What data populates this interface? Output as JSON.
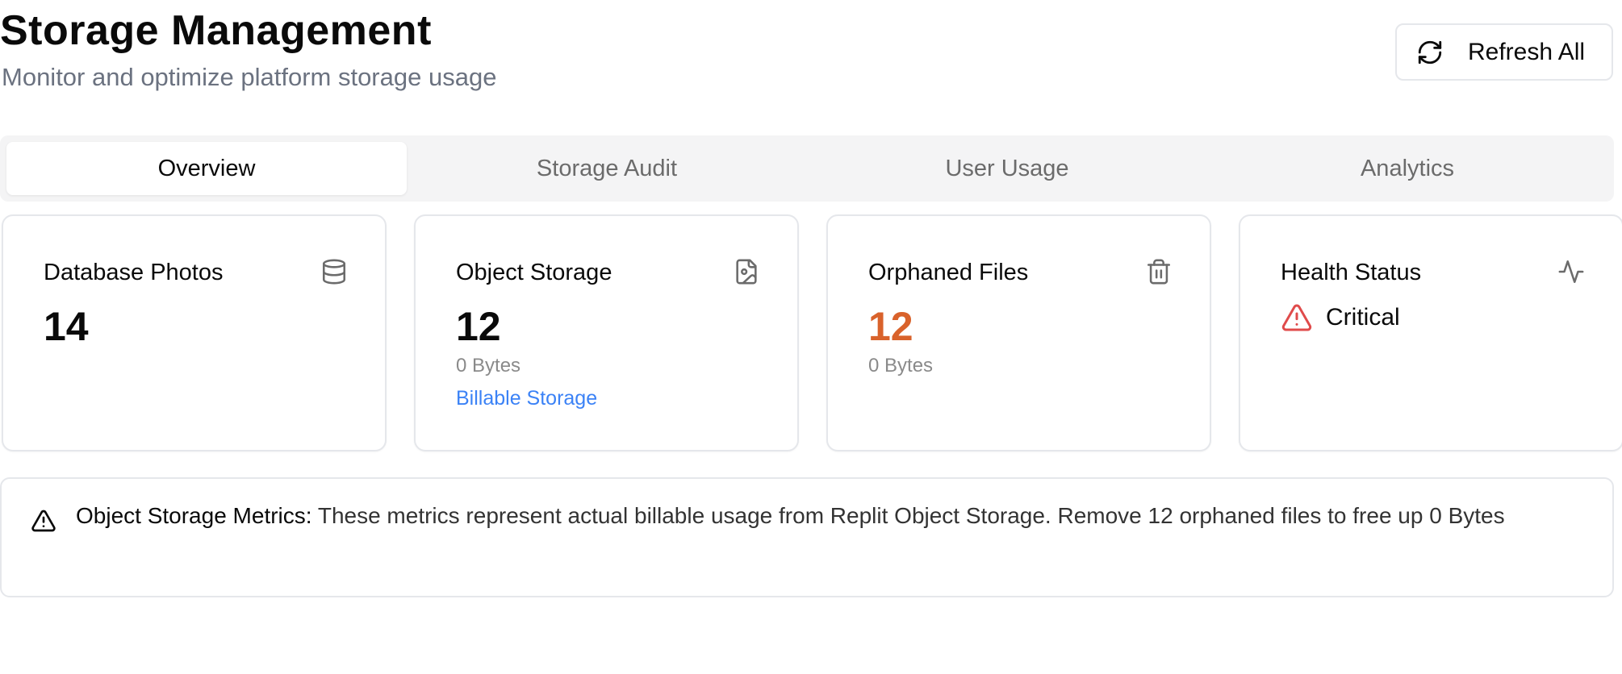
{
  "header": {
    "title": "Storage Management",
    "subtitle": "Monitor and optimize platform storage usage",
    "refresh_label": "Refresh All",
    "refresh_icon": "refresh-icon"
  },
  "tabs": [
    {
      "label": "Overview",
      "active": true
    },
    {
      "label": "Storage Audit",
      "active": false
    },
    {
      "label": "User Usage",
      "active": false
    },
    {
      "label": "Analytics",
      "active": false
    }
  ],
  "cards": {
    "database_photos": {
      "title": "Database Photos",
      "value": "14",
      "icon": "database-icon"
    },
    "object_storage": {
      "title": "Object Storage",
      "value": "12",
      "size": "0 Bytes",
      "link": "Billable Storage",
      "icon": "file-image-icon"
    },
    "orphaned_files": {
      "title": "Orphaned Files",
      "value": "12",
      "size": "0 Bytes",
      "icon": "trash-icon"
    },
    "health_status": {
      "title": "Health Status",
      "status": "Critical",
      "icon": "activity-icon",
      "status_icon": "alert-triangle-icon"
    }
  },
  "alert": {
    "heading": "Object Storage Metrics:",
    "body": " These metrics represent actual billable usage from Replit Object Storage. Remove 12 orphaned files to free up 0 Bytes",
    "icon": "alert-triangle-icon"
  },
  "colors": {
    "warning": "#d9622b",
    "critical": "#e04b4b",
    "link": "#3b82f6",
    "muted": "#6b7280",
    "border": "#e5e7eb",
    "tab_bg": "#f4f4f5"
  }
}
